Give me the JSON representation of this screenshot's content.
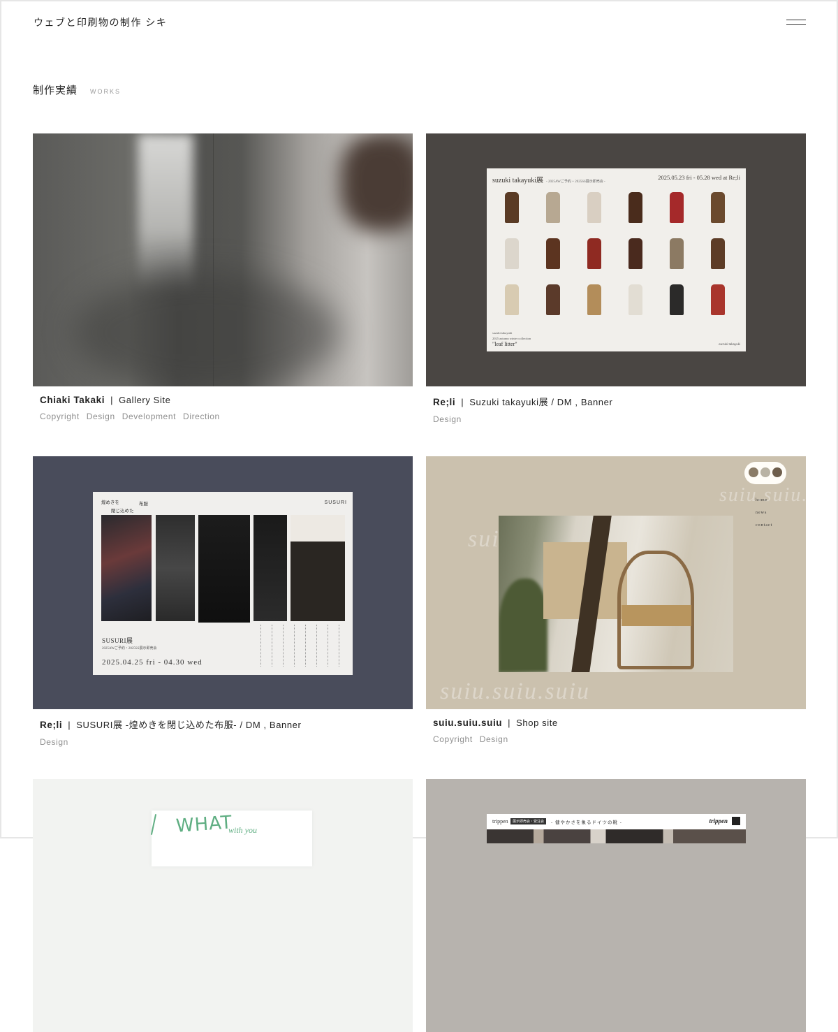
{
  "site": {
    "title": "ウェブと印刷物の制作 シキ",
    "menu_icon": "hamburger-icon"
  },
  "section": {
    "title_jp": "制作実績",
    "title_en": "WORKS"
  },
  "works": [
    {
      "client": "Chiaki Takaki",
      "separator": "|",
      "project": "Gallery Site",
      "tags": [
        "Copyright",
        "Design",
        "Development",
        "Direction"
      ]
    },
    {
      "client": "Re;li",
      "separator": "|",
      "project": "Suzuki takayuki展 / DM , Banner",
      "tags": [
        "Design"
      ],
      "thumb_text": {
        "heading": "suzuki takayuki展",
        "heading_sub": "- 2025AWご予約 + 2025SS展示即売会 -",
        "dates": "2025.05.23 fri - 05.28 wed at Re;li",
        "foot_line1": "suzuki takayuki",
        "foot_line2": "2025 autumn winter collection",
        "foot_title": "\"leaf litter\"",
        "foot_signature": "-suzuki takayuki"
      }
    },
    {
      "client": "Re;li",
      "separator": "|",
      "project": "SUSURI展 -煌めきを閉じ込めた布服- / DM , Banner",
      "tags": [
        "Design"
      ],
      "thumb_text": {
        "tagline_1": "煌めきを",
        "tagline_2": "閉じ込めた",
        "tagline_3": "布服",
        "brand": "SUSURI",
        "title": "SUSURI展",
        "sub": "2025AWご予約・2025SS展示即売会",
        "date": "2025.04.25 fri - 04.30 wed"
      }
    },
    {
      "client": "suiu.suiu.suiu",
      "separator": "|",
      "project": "Shop site",
      "tags": [
        "Copyright",
        "Design"
      ],
      "thumb_text": {
        "nav": [
          "home",
          "news",
          "contact"
        ],
        "script": "suiu.suiu.suiu"
      }
    },
    {
      "thumb_text": {
        "what": "WHAT",
        "with": "with you"
      }
    },
    {
      "thumb_text": {
        "brand": "trippen",
        "badge": "展示即売会・受注会",
        "heading": "- 健やかさを象るドイツの靴 -",
        "logo": "trippen"
      }
    }
  ]
}
